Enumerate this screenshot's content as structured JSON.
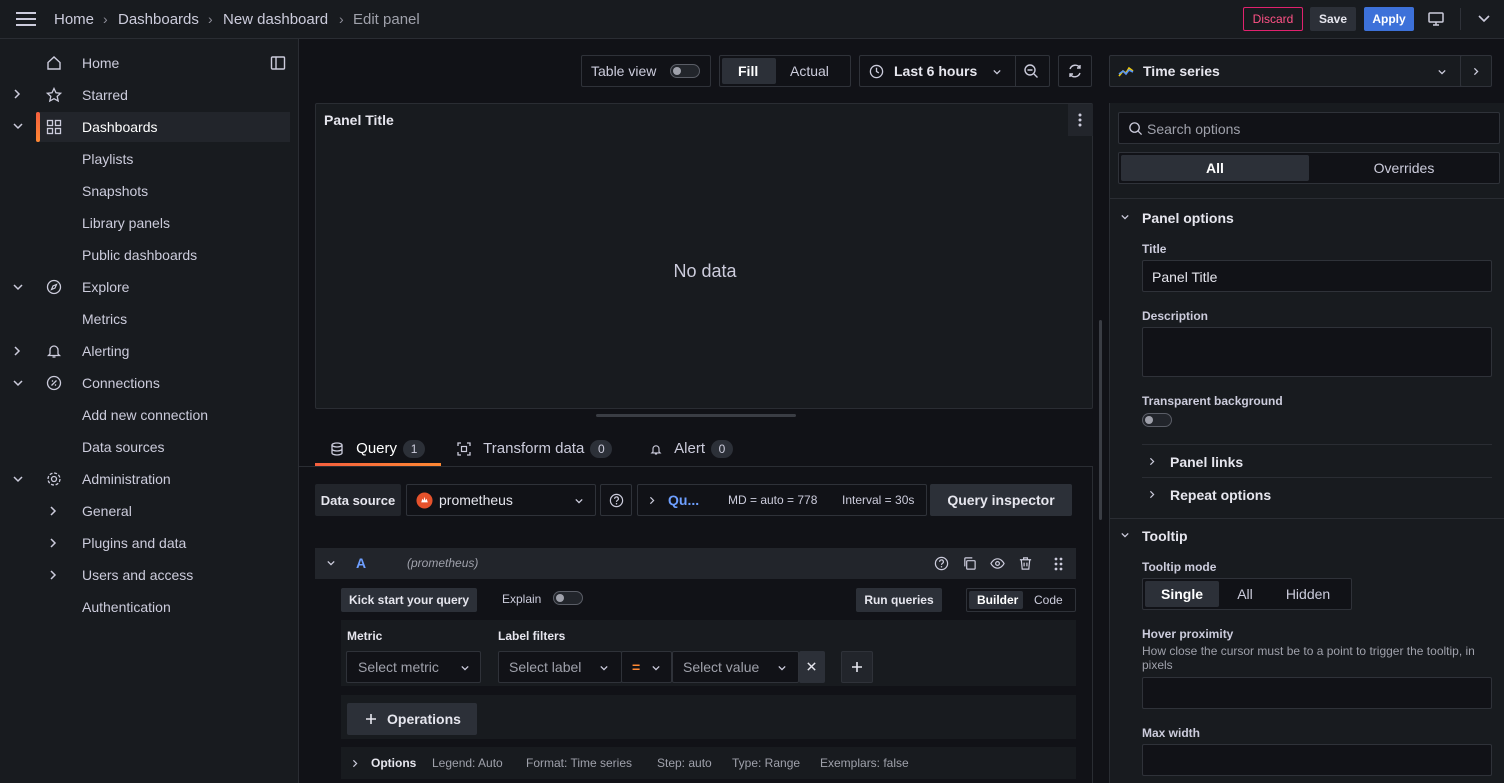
{
  "breadcrumbs": [
    "Home",
    "Dashboards",
    "New dashboard",
    "Edit panel"
  ],
  "topbar": {
    "discard": "Discard",
    "save": "Save",
    "apply": "Apply"
  },
  "sidebar": {
    "items": [
      {
        "label": "Home"
      },
      {
        "label": "Starred"
      },
      {
        "label": "Dashboards"
      },
      {
        "label": "Playlists"
      },
      {
        "label": "Snapshots"
      },
      {
        "label": "Library panels"
      },
      {
        "label": "Public dashboards"
      },
      {
        "label": "Explore"
      },
      {
        "label": "Metrics"
      },
      {
        "label": "Alerting"
      },
      {
        "label": "Connections"
      },
      {
        "label": "Add new connection"
      },
      {
        "label": "Data sources"
      },
      {
        "label": "Administration"
      },
      {
        "label": "General"
      },
      {
        "label": "Plugins and data"
      },
      {
        "label": "Users and access"
      },
      {
        "label": "Authentication"
      }
    ]
  },
  "toolbar": {
    "table_view": "Table view",
    "fill": "Fill",
    "actual": "Actual",
    "time_range": "Last 6 hours"
  },
  "panel": {
    "title": "Panel Title",
    "no_data": "No data"
  },
  "tabs": [
    {
      "label": "Query",
      "count": "1"
    },
    {
      "label": "Transform data",
      "count": "0"
    },
    {
      "label": "Alert",
      "count": "0"
    }
  ],
  "query": {
    "datasource_label": "Data source",
    "datasource": "prometheus",
    "qu": "Qu...",
    "md": "MD = auto = 778",
    "interval": "Interval = 30s",
    "inspector": "Query inspector",
    "ref": "A",
    "ref_ds": "(prometheus)",
    "kick_start": "Kick start your query",
    "explain": "Explain",
    "run_queries": "Run queries",
    "builder": "Builder",
    "code": "Code",
    "metric_label": "Metric",
    "label_filters_label": "Label filters",
    "metric_placeholder": "Select metric",
    "label_placeholder": "Select label",
    "op": "=",
    "value_placeholder": "Select value",
    "operations": "Operations",
    "options": "Options",
    "legend": "Legend: Auto",
    "format": "Format: Time series",
    "step": "Step: auto",
    "type": "Type: Range",
    "exemplars": "Exemplars: false"
  },
  "options_pane": {
    "viz": "Time series",
    "search_placeholder": "Search options",
    "tab_all": "All",
    "tab_overrides": "Overrides",
    "panel_options": "Panel options",
    "title_label": "Title",
    "title_value": "Panel Title",
    "description_label": "Description",
    "transparent_label": "Transparent background",
    "panel_links": "Panel links",
    "repeat_options": "Repeat options",
    "tooltip": "Tooltip",
    "tooltip_mode": "Tooltip mode",
    "mode_single": "Single",
    "mode_all": "All",
    "mode_hidden": "Hidden",
    "hover_proximity": "Hover proximity",
    "hover_desc": "How close the cursor must be to a point to trigger the tooltip, in pixels",
    "max_width": "Max width"
  },
  "colors": {
    "accent": "#3d71d9",
    "discard": "#e0226e",
    "active_bar": "#f55f3e",
    "link": "#6e9fff"
  }
}
